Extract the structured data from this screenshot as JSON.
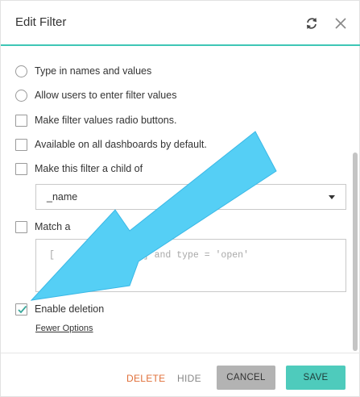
{
  "dialog": {
    "title": "Edit Filter",
    "refresh_icon": "refresh-icon",
    "close_icon": "close-icon"
  },
  "options": [
    {
      "type": "radio",
      "label": "Type in names and values",
      "checked": false
    },
    {
      "type": "radio",
      "label": "Allow users to enter filter values",
      "checked": false
    },
    {
      "type": "checkbox",
      "label": "Make filter values radio buttons.",
      "checked": false
    },
    {
      "type": "checkbox",
      "label": "Available on all dashboards by default.",
      "checked": false
    },
    {
      "type": "checkbox",
      "label": "Make this filter a child of",
      "checked": false
    }
  ],
  "parent_select": {
    "value": "_name"
  },
  "match": {
    "label_visible": "Match a"
  },
  "sql_textarea": {
    "left_fragment": "[",
    "right_fragment": "de] and type = 'open'"
  },
  "enable_deletion": {
    "label": "Enable deletion",
    "checked": true
  },
  "fewer_options": "Fewer Options",
  "footer": {
    "delete": "DELETE",
    "hide": "HIDE",
    "cancel": "CANCEL",
    "save": "SAVE"
  },
  "colors": {
    "accent": "#4ecbbc",
    "delete": "#e0703a",
    "arrow": "#55cff5"
  }
}
